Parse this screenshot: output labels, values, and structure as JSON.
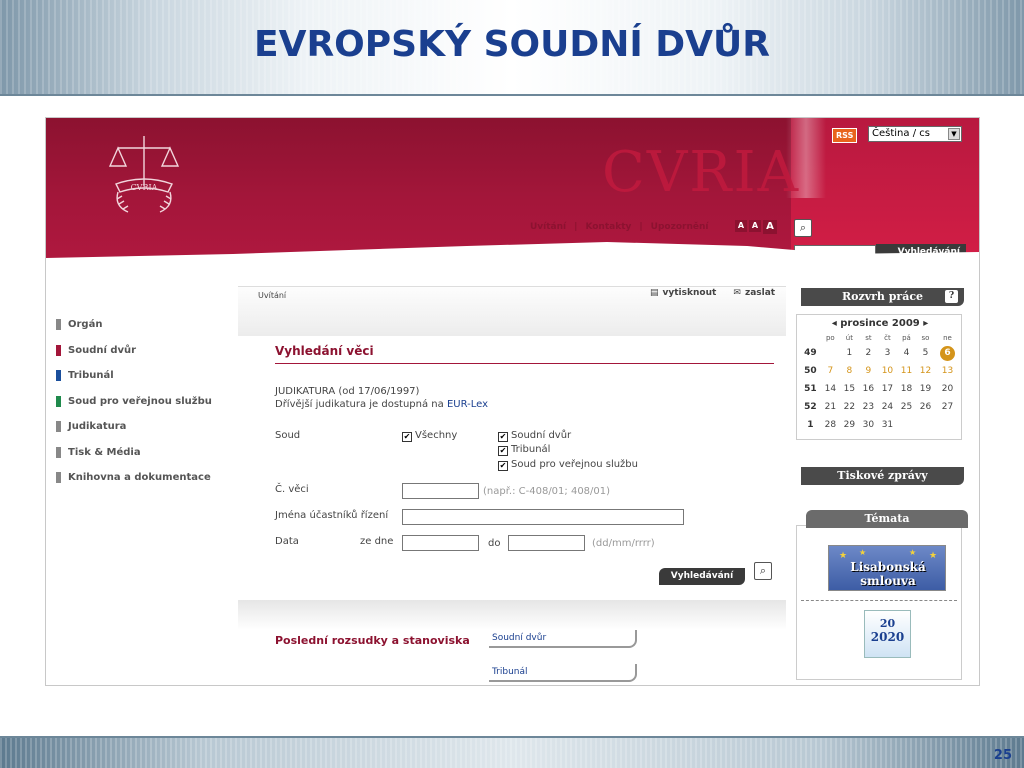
{
  "slide": {
    "title": "EVROPSKÝ SOUDNÍ DVŮR",
    "page_number": "25"
  },
  "header": {
    "logo_text": "CVRIA",
    "watermark": "CVRIA",
    "rss": "RSS",
    "language": "Čeština / cs",
    "nav": [
      "Uvítání",
      "Kontakty",
      "Upozornění"
    ],
    "font_size_buttons": [
      "A",
      "A",
      "A"
    ],
    "search_button": "Vyhledávání"
  },
  "sidebar": {
    "items": [
      {
        "label": "Orgán",
        "color": "#888888"
      },
      {
        "label": "Soudní dvůr",
        "color": "#a3163a"
      },
      {
        "label": "Tribunál",
        "color": "#1a4f9c"
      },
      {
        "label": "Soud pro veřejnou službu",
        "color": "#1f8a4c"
      },
      {
        "label": "Judikatura",
        "color": "#888888"
      },
      {
        "label": "Tisk & Média",
        "color": "#888888"
      },
      {
        "label": "Knihovna a dokumentace",
        "color": "#888888"
      }
    ]
  },
  "main": {
    "breadcrumb": "Uvítání",
    "print": "vytisknout",
    "send": "zaslat",
    "heading": "Vyhledání věci",
    "info_line1": "JUDIKATURA (od 17/06/1997)",
    "info_line2_prefix": "Dřívější judikatura je dostupná na ",
    "info_link": "EUR-Lex",
    "soud_label": "Soud",
    "all_courts": "Všechny",
    "courts": [
      "Soudní dvůr",
      "Tribunál",
      "Soud pro veřejnou službu"
    ],
    "case_label": "Č. věci",
    "case_hint": "(např.: C-408/01; 408/01)",
    "parties_label": "Jména účastníků řízení",
    "date_label": "Data",
    "date_from": "ze dne",
    "date_to": "do",
    "date_hint": "(dd/mm/rrrr)",
    "search_button": "Vyhledávání",
    "latest_heading": "Poslední rozsudky a stanoviska",
    "latest_tabs": [
      "Soudní dvůr",
      "Tribunál"
    ]
  },
  "right": {
    "calendar_header": "Rozvrh práce",
    "calendar_help": "?",
    "month": "prosince 2009",
    "days": [
      "po",
      "út",
      "st",
      "čt",
      "pá",
      "so",
      "ne"
    ],
    "weeks": [
      {
        "wk": "49",
        "d": [
          "",
          "1",
          "2",
          "3",
          "4",
          "5",
          "6"
        ]
      },
      {
        "wk": "50",
        "d": [
          "7",
          "8",
          "9",
          "10",
          "11",
          "12",
          "13"
        ]
      },
      {
        "wk": "51",
        "d": [
          "14",
          "15",
          "16",
          "17",
          "18",
          "19",
          "20"
        ]
      },
      {
        "wk": "52",
        "d": [
          "21",
          "22",
          "23",
          "24",
          "25",
          "26",
          "27"
        ]
      },
      {
        "wk": "1",
        "d": [
          "28",
          "29",
          "30",
          "31",
          "",
          "",
          ""
        ]
      }
    ],
    "press_header": "Tiskové zprávy",
    "topics_header": "Témata",
    "lisbon_banner": "Lisabonská smlouva",
    "europe2020": "2020",
    "europe2020_top": "20"
  },
  "colors": {
    "brand_red": "#a3163a",
    "title_blue": "#1a3f8f",
    "highlight_gold": "#d4941a"
  }
}
